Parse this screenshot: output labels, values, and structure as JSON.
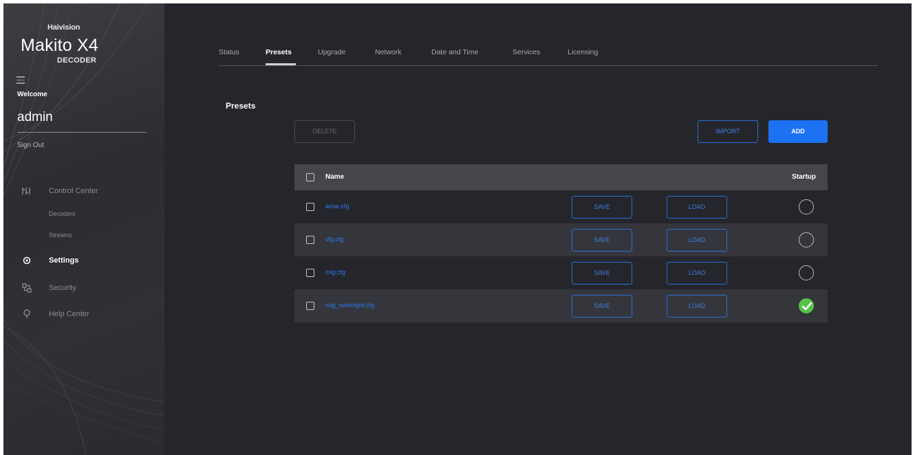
{
  "brand": {
    "company": "Haivision",
    "product": "Makito X4",
    "subtitle": "DECODER"
  },
  "user": {
    "welcome": "Welcome",
    "name": "admin",
    "sign_out": "Sign Out"
  },
  "sidebar": {
    "items": [
      {
        "label": "Control Center",
        "icon": "control-center-icon",
        "active": false
      },
      {
        "label": "Settings",
        "icon": "gear-icon",
        "active": true
      },
      {
        "label": "Security",
        "icon": "security-icon",
        "active": false
      },
      {
        "label": "Help Center",
        "icon": "help-center-icon",
        "active": false
      }
    ],
    "subitems": [
      "Decoders",
      "Streams"
    ]
  },
  "tabs": [
    "Status",
    "Presets",
    "Upgrade",
    "Network",
    "Date and Time",
    "Services",
    "Licensing"
  ],
  "active_tab": "Presets",
  "page": {
    "title": "Presets",
    "delete_label": "DELETE",
    "import_label": "IMPORT",
    "add_label": "ADD"
  },
  "table": {
    "columns": [
      "Name",
      "Startup"
    ],
    "rows": [
      {
        "name": "amar.cfg",
        "save": "SAVE",
        "load": "LOAD",
        "startup": false
      },
      {
        "name": "cfg.cfg",
        "save": "SAVE",
        "load": "LOAD",
        "startup": false
      },
      {
        "name": "mig.cfg",
        "save": "SAVE",
        "load": "LOAD",
        "startup": false
      },
      {
        "name": "mig_overnight.cfg",
        "save": "SAVE",
        "load": "LOAD",
        "startup": true
      }
    ]
  },
  "colors": {
    "accent": "#1c72f2",
    "link": "#2a7af0",
    "startup_on": "#56c24a",
    "background": "#25262b",
    "row_alt": "#35363c",
    "header": "#45464c"
  }
}
